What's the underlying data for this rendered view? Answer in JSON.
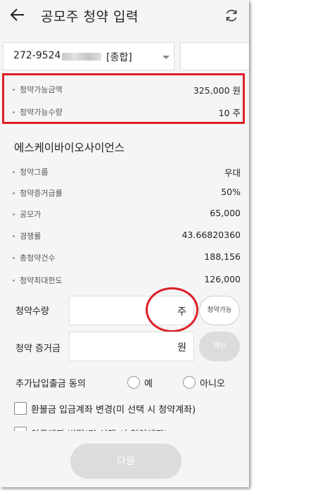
{
  "header": {
    "title": "공모주 청약 입력",
    "back_icon": "back-arrow-icon",
    "refresh_icon": "refresh-icon"
  },
  "account": {
    "number": "272-9524",
    "type": "[종합]"
  },
  "summary": [
    {
      "label": "청약가능금액",
      "value": "325,000 원"
    },
    {
      "label": "청약가능수량",
      "value": "10 주"
    }
  ],
  "company": "에스케이바이오사이언스",
  "details": [
    {
      "label": "청약그룹",
      "value": "우대"
    },
    {
      "label": "청약증거금률",
      "value": "50%"
    },
    {
      "label": "공모가",
      "value": "65,000"
    },
    {
      "label": "경쟁률",
      "value": "43.66820360"
    },
    {
      "label": "총청약건수",
      "value": "188,156"
    },
    {
      "label": "청약최대한도",
      "value": "126,000"
    }
  ],
  "form": {
    "qty_label": "청약수량",
    "qty_unit": "주",
    "avail_button": "청약가능",
    "deposit_label": "청약 증거금",
    "deposit_unit": "원",
    "calc_button": "계산",
    "extra_label": "추가납입출금 동의",
    "yes": "예",
    "no": "아니오",
    "refund_check": "환불금 입금계좌 변경(미 선택 시 청약계좌)",
    "second_check": "입금계좌 변경(미 선택 시 청약계좌)"
  },
  "footer": {
    "next": "다음"
  },
  "colors": {
    "highlight": "#e01e2a"
  }
}
